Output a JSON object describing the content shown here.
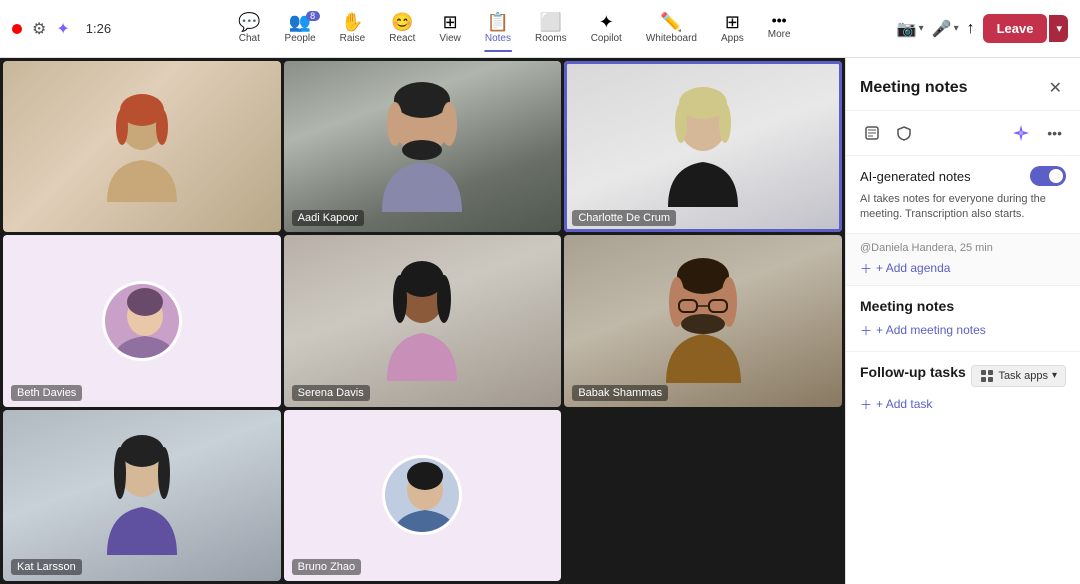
{
  "topbar": {
    "timer": "1:26",
    "nav_items": [
      {
        "id": "chat",
        "label": "Chat",
        "icon": "💬",
        "badge": null,
        "active": false
      },
      {
        "id": "people",
        "label": "People",
        "icon": "👥",
        "badge": "8",
        "active": false
      },
      {
        "id": "raise",
        "label": "Raise",
        "icon": "✋",
        "badge": null,
        "active": false
      },
      {
        "id": "react",
        "label": "React",
        "icon": "😊",
        "badge": null,
        "active": false
      },
      {
        "id": "view",
        "label": "View",
        "icon": "⊞",
        "badge": null,
        "active": false
      },
      {
        "id": "notes",
        "label": "Notes",
        "icon": "📋",
        "badge": null,
        "active": true
      },
      {
        "id": "rooms",
        "label": "Rooms",
        "icon": "⬜",
        "badge": null,
        "active": false
      },
      {
        "id": "copilot",
        "label": "Copilot",
        "icon": "✦",
        "badge": null,
        "active": false
      },
      {
        "id": "whiteboard",
        "label": "Whiteboard",
        "icon": "✏️",
        "badge": null,
        "active": false
      },
      {
        "id": "apps",
        "label": "Apps",
        "icon": "⊞",
        "badge": null,
        "active": false
      },
      {
        "id": "more",
        "label": "More",
        "icon": "•••",
        "badge": null,
        "active": false
      }
    ],
    "controls": [
      {
        "id": "camera",
        "label": "Camera",
        "icon": "📷"
      },
      {
        "id": "mic",
        "label": "Mic",
        "icon": "🎤"
      },
      {
        "id": "share",
        "label": "Share",
        "icon": "↑"
      }
    ],
    "leave_label": "Leave"
  },
  "participants": [
    {
      "id": "p1",
      "name": "Aadi Kapoor",
      "bg": "office",
      "type": "photo",
      "row": 1,
      "col": 2,
      "active": false
    },
    {
      "id": "p2",
      "name": "Charlotte De Crum",
      "bg": "white-room",
      "type": "photo",
      "row": 1,
      "col": 3,
      "active": true
    },
    {
      "id": "p3",
      "name": "Beth Davies",
      "bg": "pink",
      "type": "avatar",
      "row": 2,
      "col": 1,
      "active": false
    },
    {
      "id": "p4",
      "name": "Serena Davis",
      "bg": "bookshelf",
      "type": "photo",
      "row": 2,
      "col": 2,
      "active": false
    },
    {
      "id": "p5",
      "name": "Babak Shammas",
      "bg": "office2",
      "type": "photo",
      "row": 2,
      "col": 3,
      "active": false
    },
    {
      "id": "p6",
      "name": "Kat Larsson",
      "bg": "office3",
      "type": "photo",
      "row": 3,
      "col": 1,
      "active": false
    },
    {
      "id": "p7",
      "name": "Bruno Zhao",
      "bg": "pink2",
      "type": "avatar",
      "row": 3,
      "col": 2,
      "active": false
    }
  ],
  "panel": {
    "title": "Meeting notes",
    "ai_notes_label": "AI-generated notes",
    "ai_notes_desc": "AI takes notes for everyone during the meeting. Transcription also starts.",
    "ai_toggle_on": true,
    "agenda_preview": "@Daniela Handera, 25 min",
    "add_agenda_label": "+ Add agenda",
    "meeting_notes_title": "Meeting notes",
    "add_notes_label": "+ Add meeting notes",
    "followup_title": "Follow-up tasks",
    "task_apps_label": "Task apps",
    "add_task_label": "+ Add task"
  }
}
